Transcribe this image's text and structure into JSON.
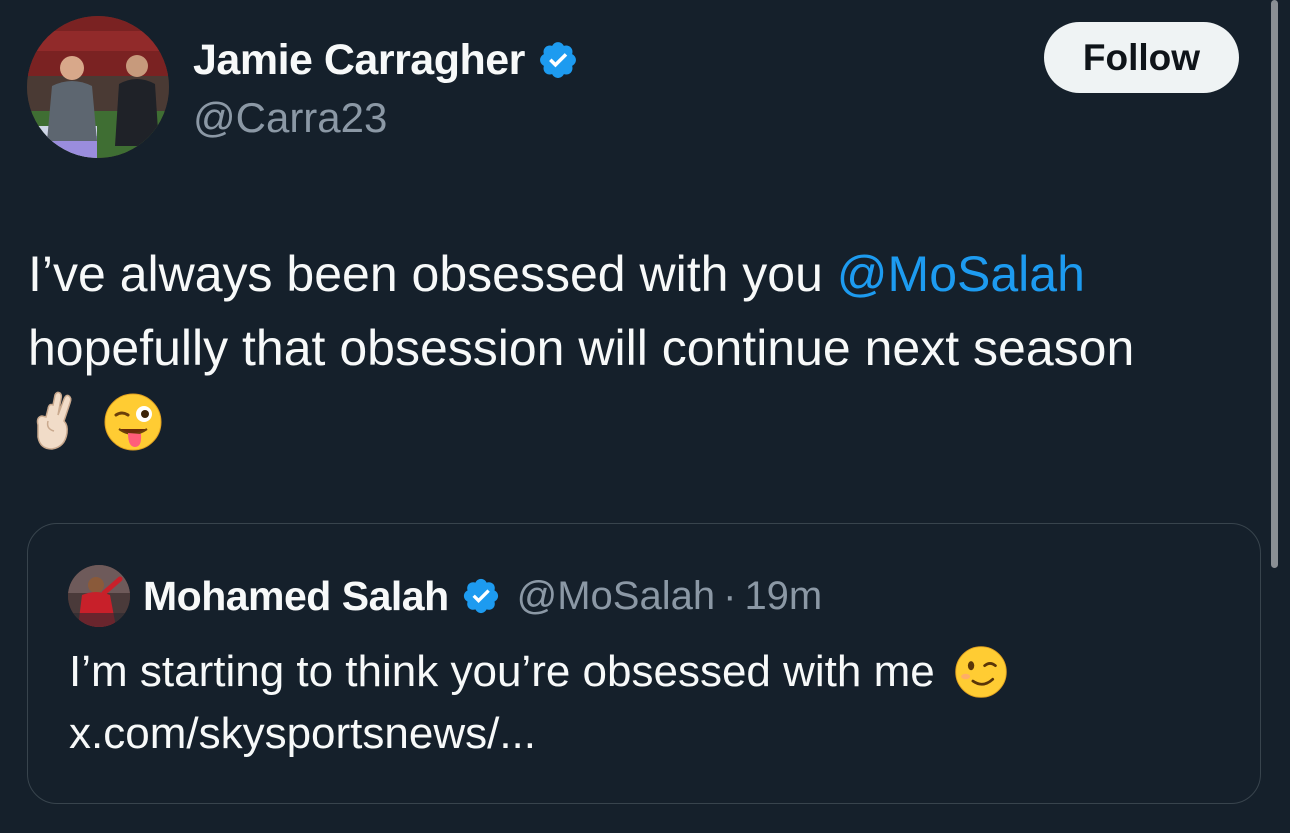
{
  "tweet": {
    "author_name": "Jamie Carragher",
    "author_handle": "@Carra23",
    "follow_label": "Follow",
    "text_line1_pre": "I’ve always been obsessed with you ",
    "mention": "@MoSalah",
    "text_line2": "hopefully that obsession will continue next season",
    "emojis": [
      "crossed-fingers",
      "winking-face-with-tongue"
    ]
  },
  "quote": {
    "author_name": "Mohamed Salah",
    "author_handle": "@MoSalah",
    "separator": "·",
    "time": "19m",
    "text": "I’m starting to think you’re obsessed with me",
    "emoji": "winking-face",
    "link": "x.com/skysportsnews/..."
  },
  "colors": {
    "background": "#15202b",
    "accent": "#1d9bf0",
    "secondary_text": "#8b98a5",
    "border": "#38444d"
  }
}
